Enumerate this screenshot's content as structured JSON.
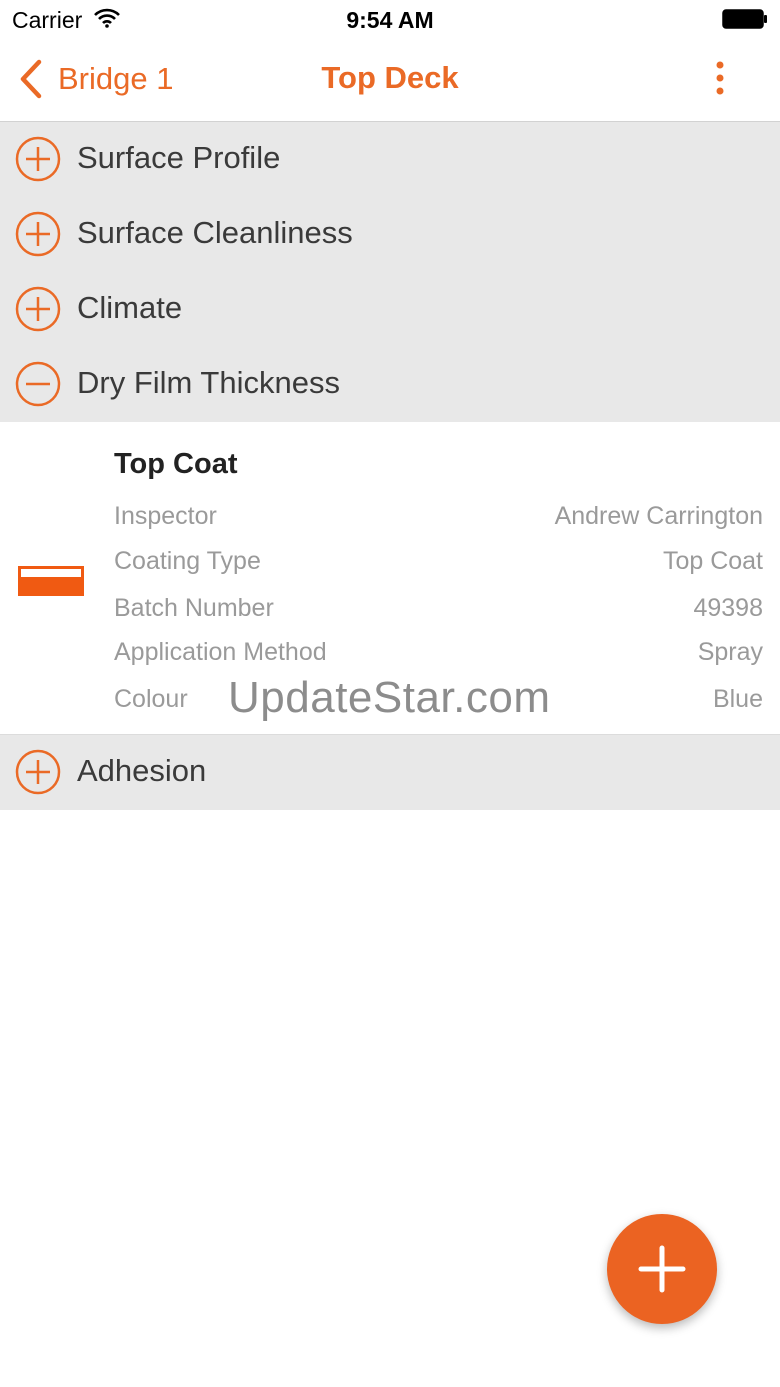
{
  "status_bar": {
    "carrier": "Carrier",
    "time": "9:54 AM"
  },
  "nav": {
    "back_label": "Bridge 1",
    "title": "Top Deck",
    "accent_color": "#ea6a26"
  },
  "sections": [
    {
      "label": "Surface Profile",
      "expanded": false
    },
    {
      "label": "Surface Cleanliness",
      "expanded": false
    },
    {
      "label": "Climate",
      "expanded": false
    },
    {
      "label": "Dry Film Thickness",
      "expanded": true
    },
    {
      "label": "Adhesion",
      "expanded": false
    }
  ],
  "detail": {
    "title": "Top Coat",
    "swatch_color": "#f05a12",
    "fields": [
      {
        "label": "Inspector",
        "value": "Andrew Carrington"
      },
      {
        "label": "Coating Type",
        "value": "Top Coat"
      },
      {
        "label": "Batch Number",
        "value": "49398"
      },
      {
        "label": "Application Method",
        "value": "Spray"
      },
      {
        "label": "Colour",
        "value": "Blue"
      }
    ]
  },
  "watermark": "UpdateStar.com",
  "fab": {
    "icon": "plus-icon",
    "color": "#eb6322"
  }
}
